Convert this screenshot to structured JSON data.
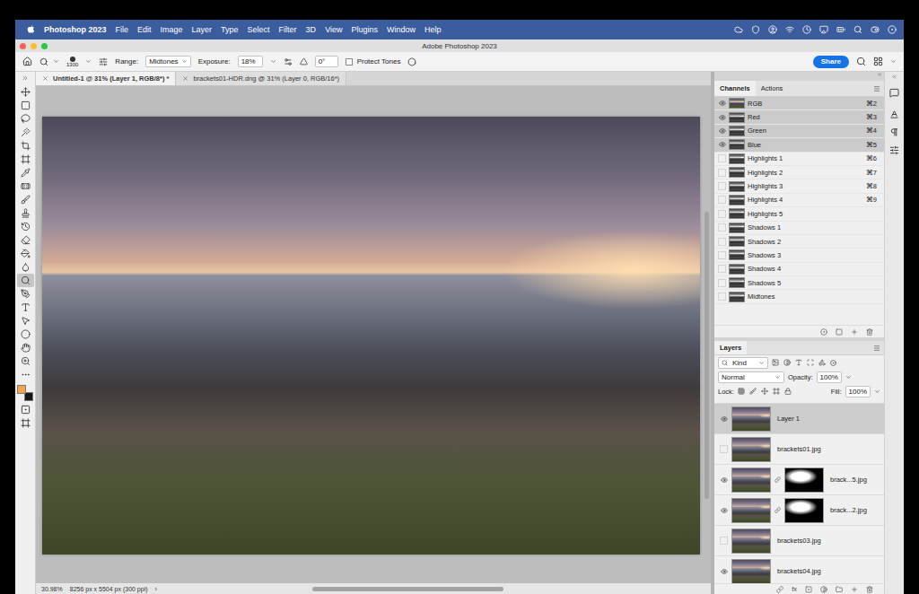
{
  "menubar": {
    "app": "Photoshop 2023",
    "items": [
      "File",
      "Edit",
      "Image",
      "Layer",
      "Type",
      "Select",
      "Filter",
      "3D",
      "View",
      "Plugins",
      "Window",
      "Help"
    ]
  },
  "window": {
    "title": "Adobe Photoshop 2023"
  },
  "options_bar": {
    "brush_size": "1300",
    "range_label": "Range:",
    "range_value": "Midtones",
    "exposure_label": "Exposure:",
    "exposure_value": "18%",
    "angle_value": "0°",
    "protect_tones": {
      "label": "Protect Tones",
      "checked": false
    },
    "share_button": "Share"
  },
  "document_tabs": [
    {
      "label": "Untitled-1 @ 31% (Layer 1, RGB/8*) *",
      "selected": true
    },
    {
      "label": "brackets01-HDR.dng @ 31% (Layer 0, RGB/16*)",
      "selected": false
    }
  ],
  "tools": [
    {
      "selected": false
    },
    {
      "selected": false
    },
    {
      "selected": false
    },
    {
      "selected": false
    },
    {
      "selected": false
    },
    {
      "selected": false
    },
    {
      "selected": false
    },
    {
      "selected": false
    },
    {
      "selected": false
    },
    {
      "selected": false
    },
    {
      "selected": false
    },
    {
      "selected": false
    },
    {
      "selected": false
    },
    {
      "selected": false
    },
    {
      "selected": true
    },
    {
      "selected": false
    },
    {
      "selected": false
    },
    {
      "selected": false
    },
    {
      "selected": false
    },
    {
      "selected": false
    },
    {
      "selected": false
    },
    {
      "selected": false
    }
  ],
  "swatches": [
    {
      "color": "#f3a64d"
    },
    {
      "color": "#161616"
    }
  ],
  "channels_panel": {
    "tabs": [
      {
        "label": "Channels",
        "selected": true
      },
      {
        "label": "Actions",
        "selected": false
      }
    ],
    "channels": [
      {
        "name": "RGB",
        "shortcut": "⌘2",
        "visible": true,
        "selected": true,
        "kind": "composite"
      },
      {
        "name": "Red",
        "shortcut": "⌘3",
        "visible": true,
        "selected": true,
        "kind": "channel"
      },
      {
        "name": "Green",
        "shortcut": "⌘4",
        "visible": true,
        "selected": true,
        "kind": "channel"
      },
      {
        "name": "Blue",
        "shortcut": "⌘5",
        "visible": true,
        "selected": true,
        "kind": "channel"
      },
      {
        "name": "Highlights 1",
        "shortcut": "⌘6",
        "visible": false,
        "selected": false,
        "kind": "channel"
      },
      {
        "name": "Highlights 2",
        "shortcut": "⌘7",
        "visible": false,
        "selected": false,
        "kind": "channel"
      },
      {
        "name": "Highlights 3",
        "shortcut": "⌘8",
        "visible": false,
        "selected": false,
        "kind": "channel"
      },
      {
        "name": "Highlights 4",
        "shortcut": "⌘9",
        "visible": false,
        "selected": false,
        "kind": "channel"
      },
      {
        "name": "Highlights 5",
        "visible": false,
        "selected": false,
        "kind": "channel"
      },
      {
        "name": "Shadows 1",
        "visible": false,
        "selected": false,
        "kind": "channel"
      },
      {
        "name": "Shadows 2",
        "visible": false,
        "selected": false,
        "kind": "channel"
      },
      {
        "name": "Shadows 3",
        "visible": false,
        "selected": false,
        "kind": "channel"
      },
      {
        "name": "Shadows 4",
        "visible": false,
        "selected": false,
        "kind": "channel"
      },
      {
        "name": "Shadows 5",
        "visible": false,
        "selected": false,
        "kind": "channel"
      },
      {
        "name": "Midtones",
        "visible": false,
        "selected": false,
        "kind": "channel"
      }
    ]
  },
  "layers_panel": {
    "title": "Layers",
    "filter": "Kind",
    "blend_mode": "Normal",
    "opacity_label": "Opacity:",
    "opacity_value": "100%",
    "lock_label": "Lock:",
    "fill_label": "Fill:",
    "fill_value": "100%",
    "fx_label": "fx",
    "layers": [
      {
        "name": "Layer 1",
        "visible": true,
        "selected": true,
        "has_mask": false
      },
      {
        "name": "brackets01.jpg",
        "visible": false,
        "selected": false,
        "has_mask": false
      },
      {
        "name": "brack...5.jpg",
        "visible": true,
        "selected": false,
        "has_mask": true
      },
      {
        "name": "brack...2.jpg",
        "visible": true,
        "selected": false,
        "has_mask": true
      },
      {
        "name": "brackets03.jpg",
        "visible": false,
        "selected": false,
        "has_mask": false
      },
      {
        "name": "brackets04.jpg",
        "visible": true,
        "selected": false,
        "has_mask": false
      }
    ]
  },
  "status_bar": {
    "zoom": "30.98%",
    "doc_info": "8256 px x 5504 px (300 ppi)",
    "arrow": "›"
  }
}
